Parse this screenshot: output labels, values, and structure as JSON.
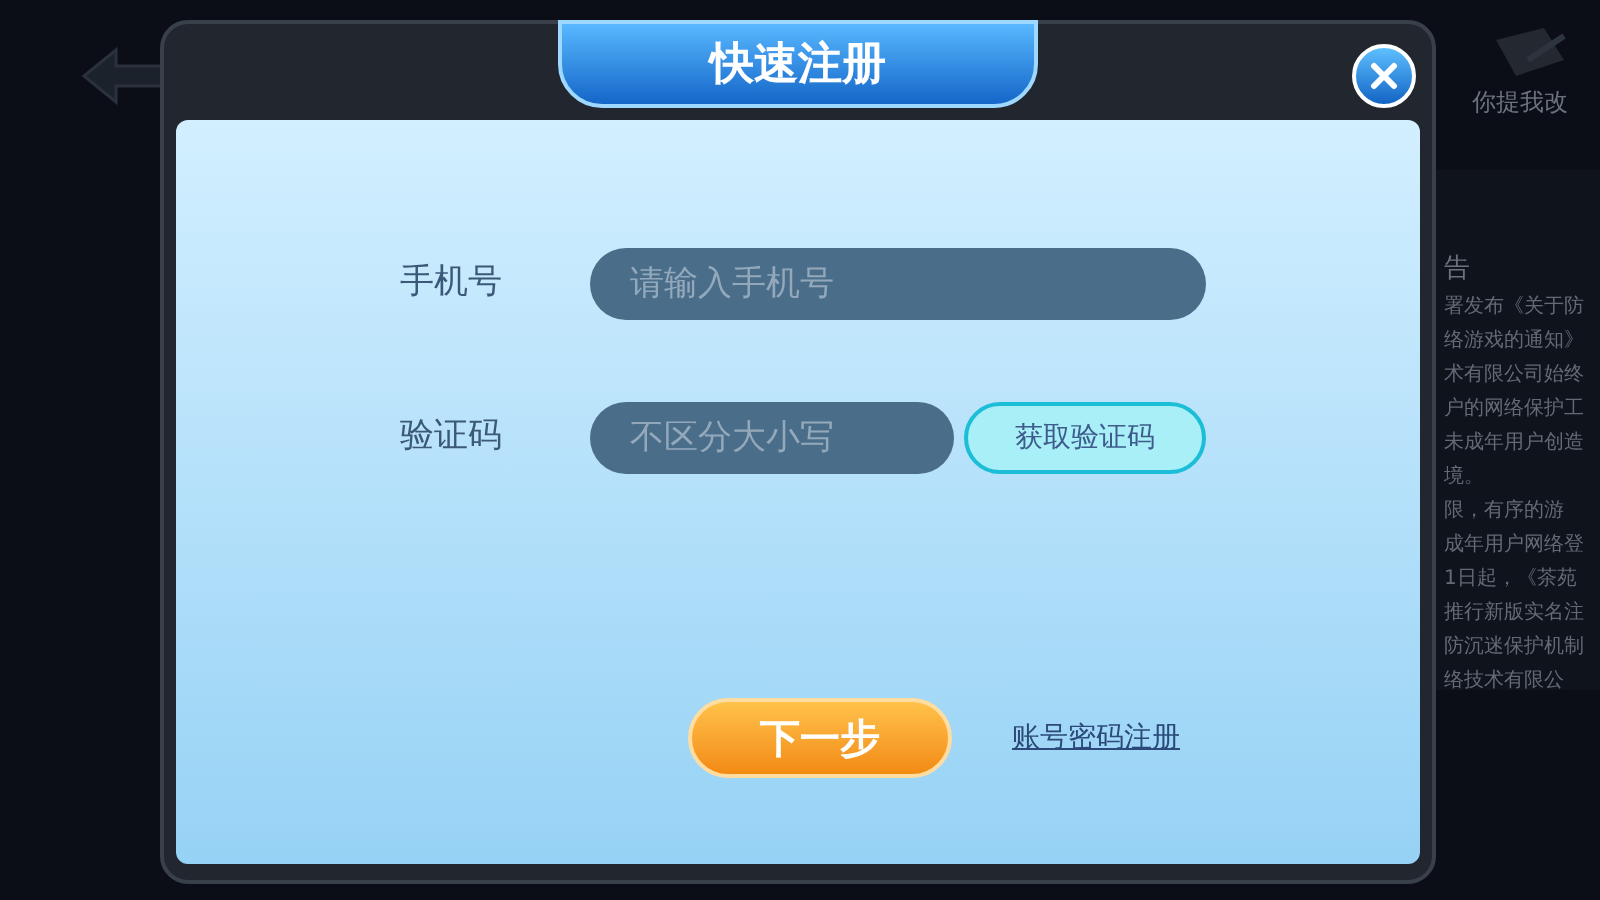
{
  "background": {
    "feedback_label": "你提我改",
    "notice_title": "告",
    "notice_lines": [
      "署发布《关于防",
      "络游戏的通知》",
      "术有限公司始终",
      "户的网络保护工",
      "未成年用户创造",
      "境。",
      "限，有序的游",
      "成年用户网络登",
      "1日起，《茶苑",
      "推行新版实名注",
      "防沉迷保护机制",
      "络技术有限公"
    ]
  },
  "dialog": {
    "title": "快速注册",
    "fields": [
      {
        "kind": "input",
        "label": "手机号",
        "placeholder": "请输入手机号"
      },
      {
        "kind": "input_with_button",
        "label": "验证码",
        "placeholder": "不区分大小写",
        "button": "获取验证码"
      }
    ],
    "next_button": "下一步",
    "account_link": "账号密码注册"
  }
}
